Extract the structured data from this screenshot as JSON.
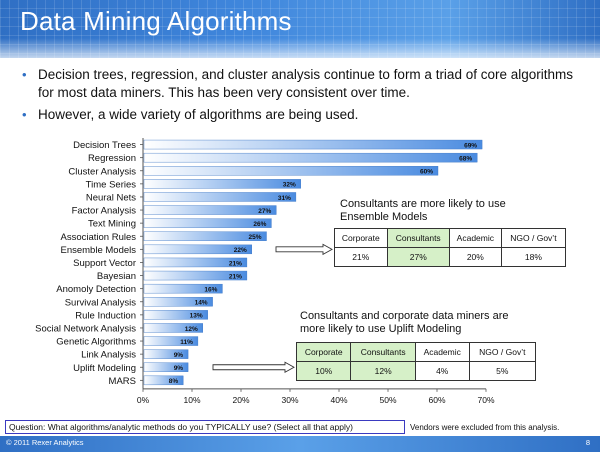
{
  "slide": {
    "title": "Data Mining Algorithms",
    "bullets": [
      "Decision trees, regression, and cluster analysis continue to form a triad of core algorithms for most data miners.  This has been very consistent over time.",
      "However, a wide variety of algorithms are being used."
    ]
  },
  "chart_data": {
    "type": "bar",
    "orientation": "horizontal",
    "categories": [
      "Decision Trees",
      "Regression",
      "Cluster Analysis",
      "Time Series",
      "Neural Nets",
      "Factor Analysis",
      "Text Mining",
      "Association Rules",
      "Ensemble Models",
      "Support Vector",
      "Bayesian",
      "Anomoly Detection",
      "Survival Analysis",
      "Rule Induction",
      "Social Network Analysis",
      "Genetic Algorithms",
      "Link Analysis",
      "Uplift Modeling",
      "MARS"
    ],
    "values": [
      69,
      68,
      60,
      32,
      31,
      27,
      26,
      25,
      22,
      21,
      21,
      16,
      14,
      13,
      12,
      11,
      9,
      9,
      8
    ],
    "value_labels": [
      "69%",
      "68%",
      "60%",
      "32%",
      "31%",
      "27%",
      "26%",
      "25%",
      "22%",
      "21%",
      "21%",
      "16%",
      "14%",
      "13%",
      "12%",
      "11%",
      "9%",
      "9%",
      "8%"
    ],
    "xlim": [
      0,
      70
    ],
    "ticks": [
      "0%",
      "10%",
      "20%",
      "30%",
      "40%",
      "50%",
      "60%",
      "70%"
    ],
    "bar_color": "#4a8be0",
    "grid": false
  },
  "ensemble_note": {
    "text_line1": "Consultants are more likely to use",
    "text_line2": "Ensemble Models",
    "headers": [
      "Corporate",
      "Consultants",
      "Academic",
      "NGO / Gov’t"
    ],
    "values": [
      "21%",
      "27%",
      "20%",
      "18%"
    ],
    "highlight_color": "#d6f0c8"
  },
  "uplift_note": {
    "text_line1": "Consultants and corporate data miners are",
    "text_line2": "more likely to use Uplift Modeling",
    "headers": [
      "Corporate",
      "Consultants",
      "Academic",
      "NGO / Gov’t"
    ],
    "values": [
      "10%",
      "12%",
      "4%",
      "5%"
    ],
    "highlight_color": "#d6f0c8"
  },
  "question": "Question:  What algorithms/analytic methods do you TYPICALLY use?  (Select all that apply)",
  "vendors_note": "Vendors were excluded from this analysis.",
  "footer": {
    "copyright": "© 2011 Rexer Analytics",
    "page": "8"
  }
}
